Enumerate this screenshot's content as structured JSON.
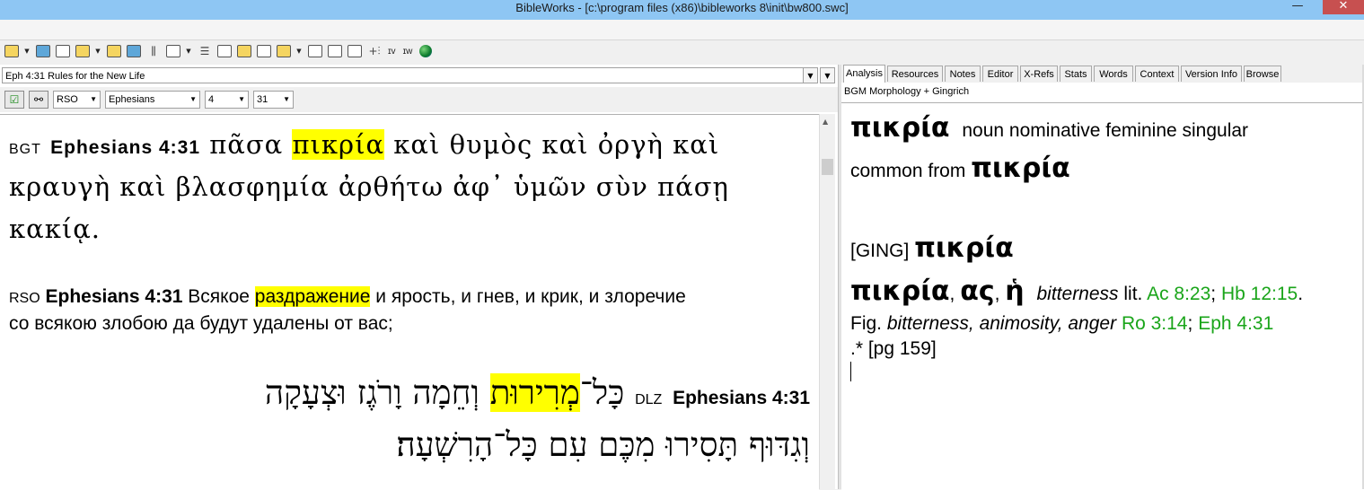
{
  "window": {
    "title": "BibleWorks - [c:\\program files (x86)\\bibleworks 8\\init\\bw800.swc]",
    "minimize": "—",
    "close": "✕"
  },
  "toolbar": {
    "text_buttons": [
      "ɪv",
      "ɪw"
    ]
  },
  "search": {
    "reference_value": "Eph 4:31 Rules for the New Life",
    "version_select": "RSO",
    "book_select": "Ephesians",
    "chapter_select": "4",
    "verse_select": "31"
  },
  "verses": {
    "bgt": {
      "version": "BGT",
      "reference": "Ephesians 4:31",
      "before": "πᾶσα",
      "highlight": "πικρία",
      "line1_rest": "καὶ θυμὸς καὶ ὀργὴ καὶ",
      "line2": "κραυγὴ καὶ βλασφημία ἀρθήτω ἀφ᾽ ὑμῶν σὺν πάσῃ",
      "line3": "κακίᾳ."
    },
    "rso": {
      "version": "RSO",
      "reference": "Ephesians 4:31",
      "before": "Всякое",
      "highlight": "раздражение",
      "line1_rest": "и ярость, и гнев, и крик, и злоречие",
      "line2": "со всякою злобою да будут удалены от вас;"
    },
    "dlz": {
      "version": "DLZ",
      "reference": "Ephesians 4:31",
      "before": "כָּל־",
      "highlight": "מְרִירוּת",
      "line1_rest": "וְחֵמָה וָרֹגֶז וּצְעָקָה",
      "line2": "וְגִדּוּף תָּסִירוּ מִכֶּם עִם כָּל־הָרִשְׁעָה׃"
    }
  },
  "tabs": [
    "Analysis",
    "Resources",
    "Notes",
    "Editor",
    "X-Refs",
    "Stats",
    "Words",
    "Context",
    "Version Info",
    "Browse"
  ],
  "analysis": {
    "source": "BGM Morphology + Gingrich",
    "word": "πικρία",
    "parse_line1": "noun nominative feminine singular",
    "parse_line2_prefix": "common from",
    "lexeme": "πικρία",
    "ging_tag": "[GING]",
    "ging_word": "πικρία",
    "entry_head_word": "πικρία",
    "entry_sep1": ",",
    "entry_ending": "ας",
    "entry_sep2": ",",
    "entry_article": "ἡ",
    "gloss1": "bitterness",
    "lit": "lit.",
    "ref1": "Ac 8:23",
    "semi1": ";",
    "ref2": "Hb 12:15",
    "dot1": ".",
    "fig": "Fig.",
    "gloss2": "bitterness, animosity, anger",
    "ref3": "Ro 3:14",
    "semi2": ";",
    "ref4": "Eph 4:31",
    "tail": ".* [pg 159]"
  },
  "colors": {
    "highlight": "#ffff00",
    "reference_link": "#1aa51a",
    "title_bar": "#8ec6f3"
  }
}
